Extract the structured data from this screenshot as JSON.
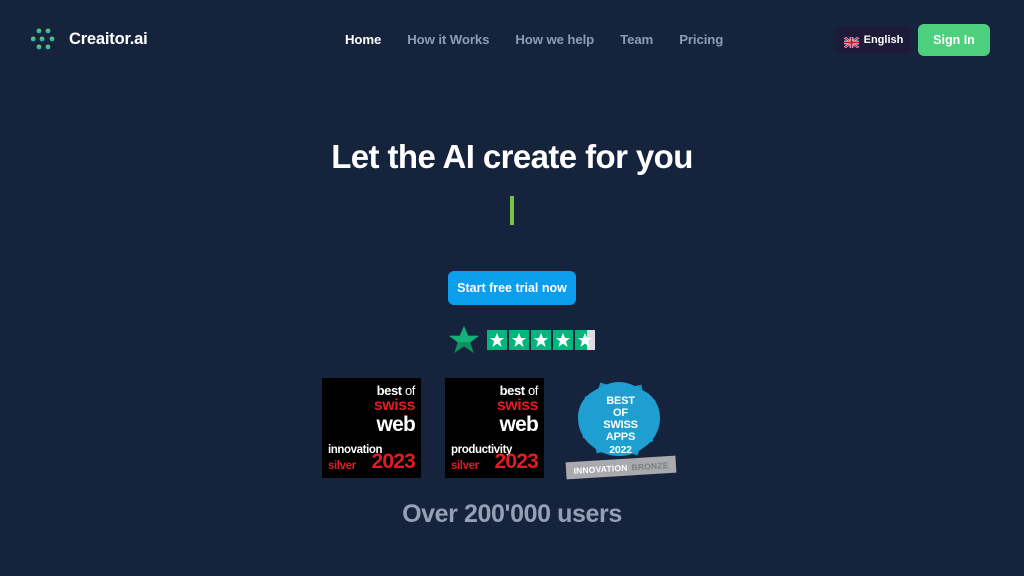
{
  "theme": {
    "background": "#15243c",
    "accent_blue": "#0d9ded",
    "accent_green": "#4cd07d",
    "cursor_green": "#76c442",
    "trustpilot_green": "#00b67a",
    "badge_red": "#e11b22",
    "muted_text": "#8e9cb3"
  },
  "header": {
    "brand": {
      "icon": "creaitor-nodes-icon",
      "name": "Creaitor.ai"
    },
    "nav": [
      {
        "label": "Home",
        "active": true
      },
      {
        "label": "How it Works",
        "active": false
      },
      {
        "label": "How we help",
        "active": false
      },
      {
        "label": "Team",
        "active": false
      },
      {
        "label": "Pricing",
        "active": false
      }
    ],
    "language": {
      "icon": "uk-flag-icon",
      "label": "English"
    },
    "signin_label": "Sign In"
  },
  "hero": {
    "headline": "Let the AI create for you",
    "typed_text": "",
    "cursor_icon": "text-cursor-icon",
    "cta_label": "Start free trial now"
  },
  "trustpilot": {
    "logo_icon": "trustpilot-star-icon",
    "rating": 4.5,
    "max_rating": 5,
    "stars": [
      {
        "fill": "full"
      },
      {
        "fill": "full"
      },
      {
        "fill": "full"
      },
      {
        "fill": "full"
      },
      {
        "fill": "half"
      }
    ]
  },
  "awards": [
    {
      "type": "square",
      "best": "best",
      "of": "of",
      "swiss": "swiss",
      "web": "web",
      "category": "innovation",
      "metal": "silver",
      "year": "2023"
    },
    {
      "type": "square",
      "best": "best",
      "of": "of",
      "swiss": "swiss",
      "web": "web",
      "category": "productivity",
      "metal": "silver",
      "year": "2023"
    },
    {
      "type": "circle",
      "line1": "BEST",
      "line2": "OF",
      "line3": "SWISS",
      "line4": "APPS",
      "year": "2022",
      "ribbon_primary": "INNOVATION",
      "ribbon_secondary": "BRONZE"
    }
  ],
  "social_proof": {
    "users_text": "Over 200'000 users"
  }
}
